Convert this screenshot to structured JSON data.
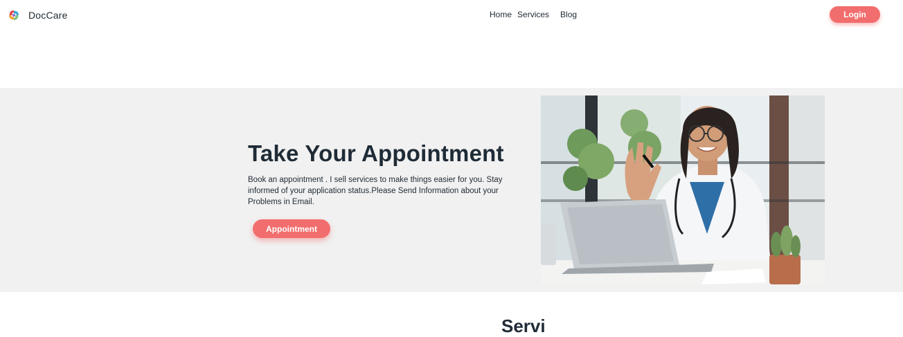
{
  "header": {
    "brand": "DocCare",
    "nav": [
      {
        "label": "Home"
      },
      {
        "label": "Services"
      },
      {
        "label": "Blog"
      }
    ],
    "login_label": "Login",
    "accent_color": "#f26d6d"
  },
  "hero": {
    "title": "Take Your Appointment",
    "description": "Book an appointment . I sell services to make things easier for you. Stay informed of your application status.Please Send Information about your Problems in Email.",
    "button_label": "Appointment",
    "background_color": "#f1f1f1",
    "image": "doctor-waving-at-laptop"
  },
  "next_section": {
    "title_partial": "Servi"
  }
}
